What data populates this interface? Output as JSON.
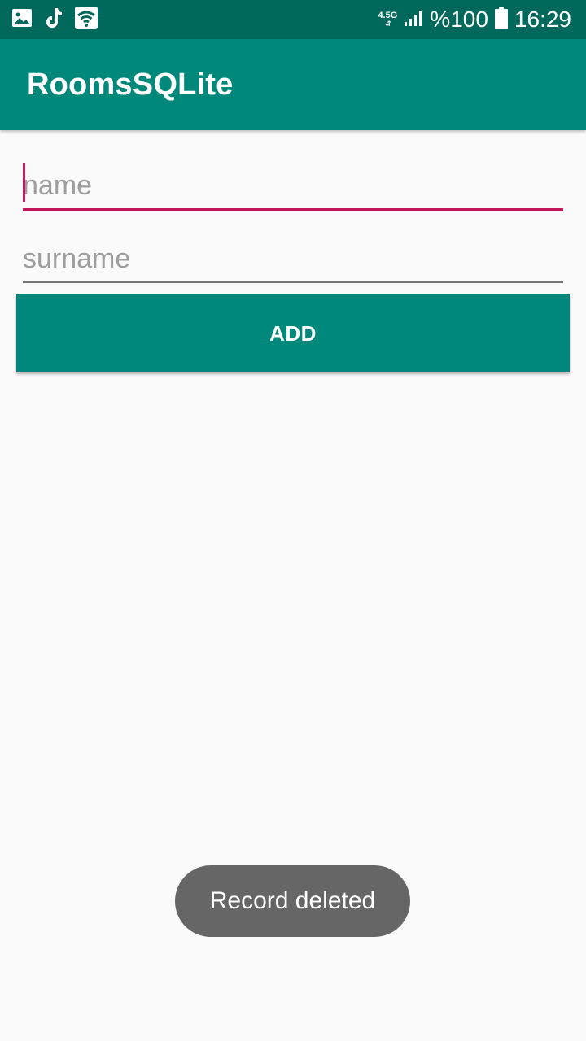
{
  "status_bar": {
    "icons": [
      "gallery-icon",
      "tiktok-icon",
      "wifi-icon"
    ],
    "network_type": "4.5G",
    "battery": "%100",
    "time": "16:29"
  },
  "app_bar": {
    "title": "RoomsSQLite"
  },
  "form": {
    "name_placeholder": "name",
    "name_value": "",
    "surname_placeholder": "surname",
    "surname_value": "",
    "add_label": "ADD"
  },
  "toast": {
    "message": "Record deleted"
  },
  "colors": {
    "primary": "#00897b",
    "primary_dark": "#00695c",
    "accent": "#c2185b"
  }
}
